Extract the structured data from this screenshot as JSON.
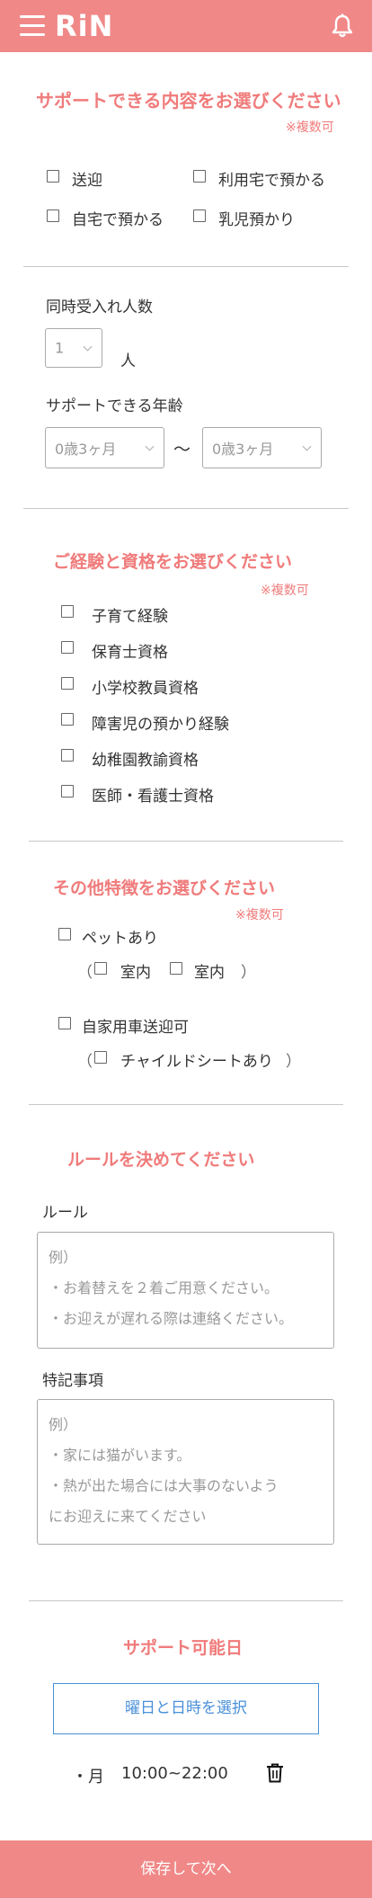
{
  "header": {
    "logo": "RiN"
  },
  "support": {
    "title": "サポートできる内容をお選びください",
    "multi_note": "※複数可",
    "options": [
      "送迎",
      "利用宅で預かる",
      "自宅で預かる",
      "乳児預かり"
    ]
  },
  "capacity": {
    "label": "同時受入れ人数",
    "value": "1",
    "unit": "人"
  },
  "age": {
    "label": "サポートできる年齢",
    "from_value": "0歳3ヶ月",
    "to_value": "0歳3ヶ月",
    "separator": "〜"
  },
  "experience": {
    "title": "ご経験と資格をお選びください",
    "multi_note": "※複数可",
    "options": [
      "子育て経験",
      "保育士資格",
      "小学校教員資格",
      "障害児の預かり経験",
      "幼稚園教諭資格",
      "医師・看護士資格"
    ]
  },
  "features": {
    "title": "その他特徴をお選びください",
    "multi_note": "※複数可",
    "pet": "ペットあり",
    "pet_open": "（",
    "pet_sub1": "室内",
    "pet_sub2": "室内",
    "pet_close": "）",
    "car": "自家用車送迎可",
    "car_open": "（",
    "car_sub": "チャイルドシートあり",
    "car_close": "）"
  },
  "rules": {
    "title": "ルールを決めてください",
    "rule_label": "ルール",
    "rule_lines": [
      "例）",
      "・お着替えを２着ご用意ください。",
      "・お迎えが遅れる際は連絡ください。"
    ],
    "notes_label": "特記事項",
    "notes_lines": [
      "例）",
      "・家には猫がいます。",
      "・熱が出た場合には大事のないよう",
      "にお迎えに来てください"
    ]
  },
  "availability": {
    "title": "サポート可能日",
    "select_button": "曜日と日時を選択",
    "entry_bullet": "・月",
    "entry_time": "10:00~22:00"
  },
  "footer": {
    "save_label": "保存して次へ"
  }
}
